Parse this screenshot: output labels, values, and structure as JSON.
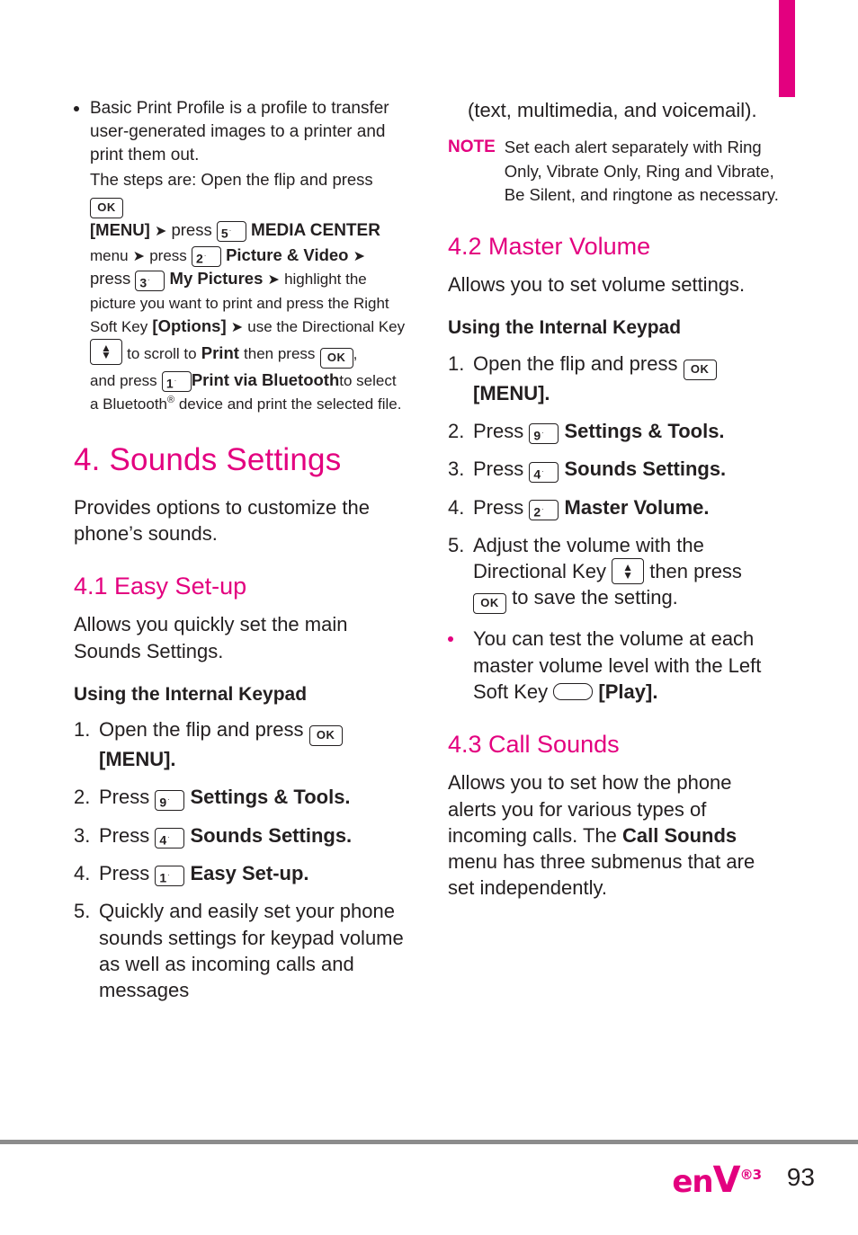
{
  "page": {
    "number": "93",
    "logo_text": "enV",
    "logo_sup": "®3"
  },
  "left_column": {
    "bullet_1": "Basic Print Profile is a profile to transfer user-generated images to a printer and print them out.",
    "steps_intro": "The steps are: Open the flip and press",
    "keys": {
      "ok": "OK",
      "five": "5",
      "five_sup": "·",
      "two": "2",
      "two_sup": "·",
      "three": "3",
      "three_sup": "·",
      "one": "1",
      "one_sup": "·",
      "four": "4",
      "four_sup": "·",
      "nine": "9",
      "nine_sup": "·"
    },
    "menu_label": "[MENU]",
    "press_1": "press",
    "media_center": "MEDIA CENTER",
    "menu_word": "menu",
    "press_2": "press",
    "picture_video": "Picture & Video",
    "press_3": "press",
    "my_pictures": "My Pictures",
    "highlight_text": "highlight the picture you want to print and press the Right Soft Key",
    "options": "[Options]",
    "use_directional": "use the Directional Key",
    "scroll_to": "to scroll to",
    "print": "Print",
    "then_press": "then press",
    "and_press": "and press",
    "print_via_bluetooth": "Print via Bluetooth",
    "select_tail": "to select a Bluetooth",
    "select_tail2": " device and print the selected file.",
    "chapter_title": "4. Sounds Settings",
    "chapter_body": "Provides options to customize the phone’s sounds.",
    "section_41": "4.1 Easy Set-up",
    "section_41_body": "Allows you quickly set the main Sounds Settings.",
    "subhead_internal_keypad": "Using the Internal Keypad",
    "steps": [
      {
        "num": "1.",
        "pre": "Open the flip and press",
        "key": "OK",
        "post": "[MENU]."
      },
      {
        "num": "2.",
        "pre": "Press",
        "key": "9",
        "post": "Settings & Tools."
      },
      {
        "num": "3.",
        "pre": "Press",
        "key": "4",
        "post": "Sounds Settings."
      },
      {
        "num": "4.",
        "pre": "Press",
        "key": "1",
        "post": "Easy Set-up."
      },
      {
        "num": "5.",
        "pre": "Quickly and easily set your phone sounds settings for keypad volume as well as incoming calls and messages",
        "key": "",
        "post": ""
      }
    ]
  },
  "right_column": {
    "continuation": "(text, multimedia, and voicemail).",
    "note_label": "NOTE",
    "note_text": "Set each alert separately with Ring Only, Vibrate Only, Ring and Vibrate, Be Silent, and ringtone as necessary.",
    "section_42": "4.2 Master Volume",
    "section_42_body": "Allows you to set volume settings.",
    "subhead_internal_keypad": "Using the Internal Keypad",
    "steps": [
      {
        "num": "1.",
        "pre": "Open the flip and press",
        "key": "OK",
        "post": "[MENU]."
      },
      {
        "num": "2.",
        "pre": "Press",
        "key": "9",
        "post": "Settings & Tools."
      },
      {
        "num": "3.",
        "pre": "Press",
        "key": "4",
        "post": "Sounds Settings."
      },
      {
        "num": "4.",
        "pre": "Press",
        "key": "2",
        "post": "Master Volume."
      },
      {
        "num": "5.",
        "pre": "Adjust the volume with the Directional Key",
        "mid": "then press",
        "post": "to save the setting."
      }
    ],
    "bullet_test": "You can test the volume at each master volume level with the Left Soft Key",
    "bullet_test_tail": "[Play].",
    "section_43": "4.3 Call Sounds",
    "section_43_body_1": "Allows you to set how the phone alerts you for various types of incoming calls. The ",
    "section_43_bold": "Call Sounds",
    "section_43_body_2": " menu has three submenus that are set independently."
  },
  "colors": {
    "magenta": "#e3007f",
    "text": "#231f20",
    "rule": "#8c8c8c"
  }
}
